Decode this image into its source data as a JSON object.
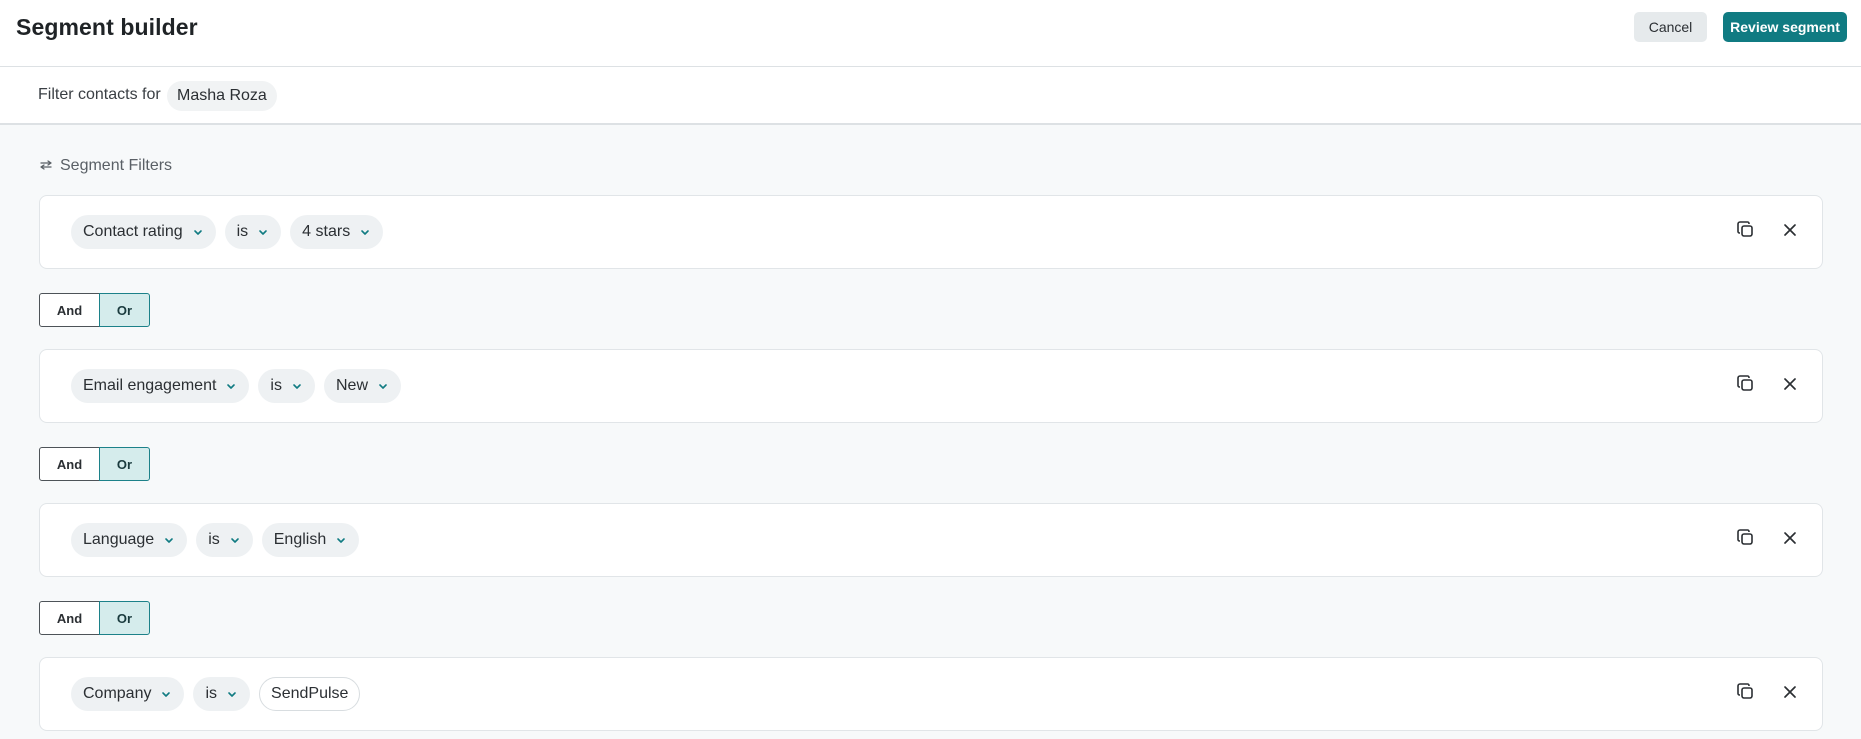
{
  "header": {
    "title": "Segment builder",
    "cancel_label": "Cancel",
    "review_label": "Review segment"
  },
  "context": {
    "label": "Filter contacts for",
    "contact": "Masha Roza"
  },
  "section": {
    "title": "Segment Filters"
  },
  "filters": [
    {
      "field": "Contact rating",
      "operator": "is",
      "value": "4 stars"
    },
    {
      "field": "Email engagement",
      "operator": "is",
      "value": "New"
    },
    {
      "field": "Language",
      "operator": "is",
      "value": "English"
    },
    {
      "field": "Company",
      "operator": "is",
      "value": "SendPulse"
    }
  ],
  "logic": {
    "and_label": "And",
    "or_label": "Or",
    "selected": "Or"
  },
  "colors": {
    "accent": "#107b82",
    "selected_bg": "#d5ecec",
    "background": "#f7f9fa"
  },
  "icons": {
    "section": "sliders-icon",
    "duplicate": "copy-icon",
    "remove": "close-icon",
    "dropdown": "chevron-down-icon"
  }
}
